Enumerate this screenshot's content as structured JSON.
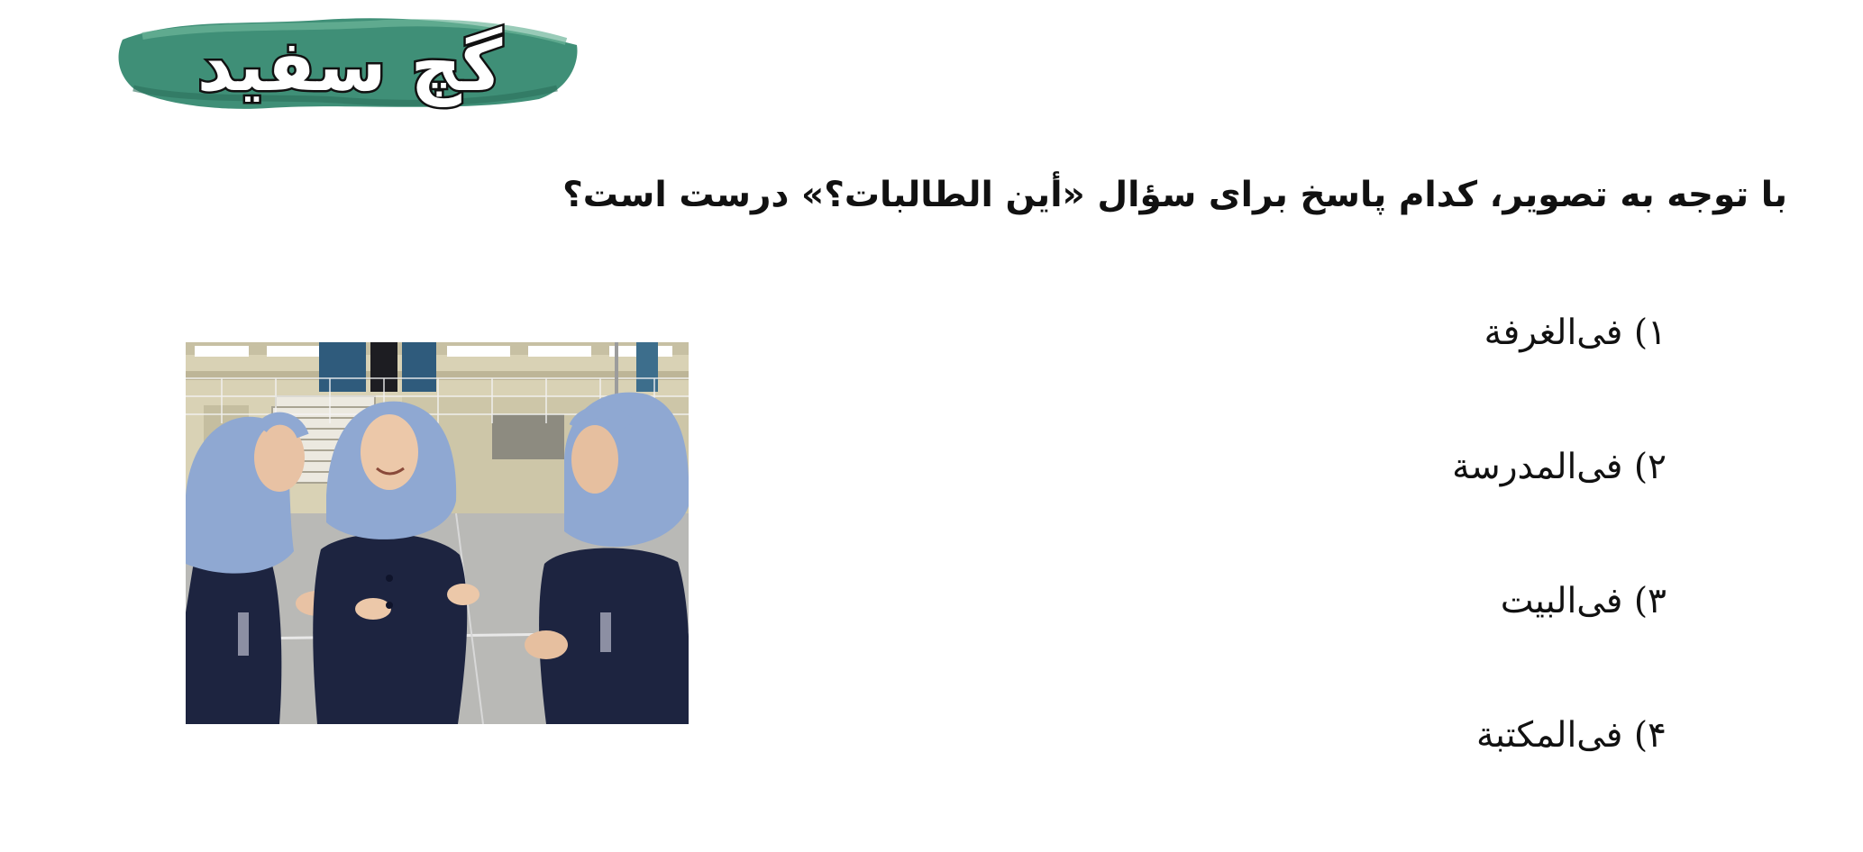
{
  "brand": {
    "logo_text": "گچ سفید",
    "colors": {
      "brush": "#3f8f77",
      "brush_light": "#6db59a",
      "lettering": "#ffffff",
      "outline": "#111111"
    }
  },
  "question": {
    "text": "با توجه به تصویر، کدام پاسخ برای سؤال «أين الطالبات؟» درست است؟"
  },
  "options": [
    {
      "label": "۱) فی‌الغرفة"
    },
    {
      "label": "۲) فی‌المدرسة"
    },
    {
      "label": "۳) فی‌البیت"
    },
    {
      "label": "۴) فی‌المکتبة"
    }
  ],
  "photo": {
    "subject": "three-schoolgirls-in-schoolyard",
    "colors": {
      "hijab": "#8fa8d2",
      "uniform": "#1d2440",
      "ground": "#b9b9b6",
      "building": "#d9d2b5"
    }
  }
}
